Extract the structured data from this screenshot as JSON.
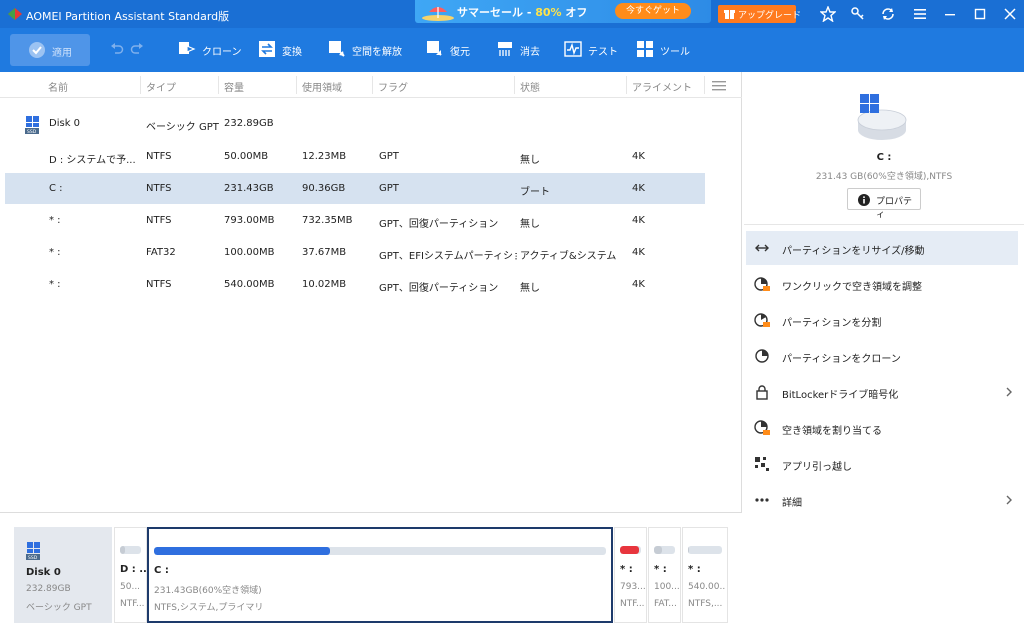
{
  "window": {
    "title": "AOMEI Partition Assistant Standard版",
    "promo_text_a": "サマーセール - ",
    "promo_pct": "80%",
    "promo_text_b": " オフ",
    "promo_button": "今すぐゲット",
    "upgrade_label": "アップグレード"
  },
  "toolbar": {
    "apply_label": "適用",
    "tools": [
      {
        "label": "クローン",
        "icon": "clone-icon"
      },
      {
        "label": "変換",
        "icon": "convert-icon"
      },
      {
        "label": "空間を解放",
        "icon": "free-space-icon"
      },
      {
        "label": "復元",
        "icon": "restore-icon"
      },
      {
        "label": "消去",
        "icon": "wipe-icon"
      },
      {
        "label": "テスト",
        "icon": "test-icon"
      },
      {
        "label": "ツール",
        "icon": "tools-icon"
      }
    ]
  },
  "table": {
    "headers": [
      "名前",
      "タイプ",
      "容量",
      "使用領域",
      "フラグ",
      "状態",
      "アライメント"
    ],
    "disk_row": {
      "name": "Disk 0",
      "type": "ベーシック GPT",
      "capacity": "232.89GB"
    },
    "rows": [
      {
        "name": "D : システムで予...",
        "type": "NTFS",
        "capacity": "50.00MB",
        "used": "12.23MB",
        "flag": "GPT",
        "status": "無し",
        "align": "4K"
      },
      {
        "name": "C :",
        "type": "NTFS",
        "capacity": "231.43GB",
        "used": "90.36GB",
        "flag": "GPT",
        "status": "ブート",
        "align": "4K"
      },
      {
        "name": "* :",
        "type": "NTFS",
        "capacity": "793.00MB",
        "used": "732.35MB",
        "flag": "GPT、回復パーティション",
        "status": "無し",
        "align": "4K"
      },
      {
        "name": "* :",
        "type": "FAT32",
        "capacity": "100.00MB",
        "used": "37.67MB",
        "flag": "GPT、EFIシステムパーティション",
        "status": "アクティブ&システム",
        "align": "4K"
      },
      {
        "name": "* :",
        "type": "NTFS",
        "capacity": "540.00MB",
        "used": "10.02MB",
        "flag": "GPT、回復パーティション",
        "status": "無し",
        "align": "4K"
      }
    ]
  },
  "side": {
    "name": "C :",
    "info": "231.43 GB(60%空き領域),NTFS",
    "properties_label": "プロパティ",
    "ops": [
      {
        "label": "パーティションをリサイズ/移動",
        "icon": "resize-icon"
      },
      {
        "label": "ワンクリックで空き領域を調整",
        "icon": "adjust-space-icon"
      },
      {
        "label": "パーティションを分割",
        "icon": "split-icon"
      },
      {
        "label": "パーティションをクローン",
        "icon": "clone-partition-icon"
      },
      {
        "label": "BitLockerドライブ暗号化",
        "icon": "bitlocker-icon"
      },
      {
        "label": "空き領域を割り当てる",
        "icon": "allocate-icon"
      },
      {
        "label": "アプリ引っ越し",
        "icon": "app-mover-icon"
      },
      {
        "label": "詳細",
        "icon": "more-icon"
      }
    ]
  },
  "diskmap": {
    "disk_name": "Disk 0",
    "disk_size": "232.89GB",
    "disk_type": "ベーシック GPT",
    "partitions": [
      {
        "l1": "D : ...",
        "l2": "50...",
        "l3": "NTF...",
        "used_fraction": 0.24,
        "color": "#c6ccd4"
      },
      {
        "l1": "C :",
        "l2": "231.43GB(60%空き領域)",
        "l3": "NTFS,システム,プライマリ",
        "used_fraction": 0.39,
        "color": "#2f6fdf"
      },
      {
        "l1": "* :",
        "l2": "793...",
        "l3": "NTF...",
        "used_fraction": 0.92,
        "color": "#e8353d"
      },
      {
        "l1": "* :",
        "l2": "100...",
        "l3": "FAT...",
        "used_fraction": 0.38,
        "color": "#c6ccd4"
      },
      {
        "l1": "* :",
        "l2": "540.00...",
        "l3": "NTFS,...",
        "used_fraction": 0.02,
        "color": "#c6ccd4"
      }
    ]
  },
  "colors": {
    "titlebar": "#1a6fd4",
    "toolbar": "#1f7ae0",
    "selection": "#d6e2f0",
    "accent": "#2f6fdf"
  }
}
